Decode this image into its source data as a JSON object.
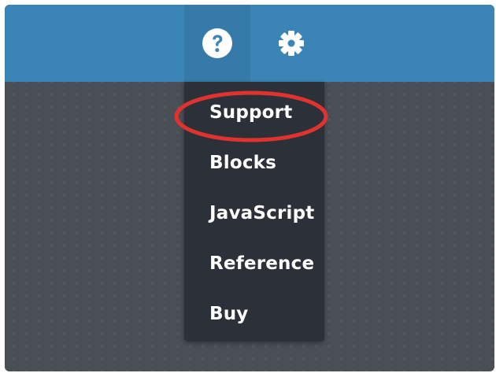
{
  "toolbar": {
    "buttons": [
      {
        "icon": "help-circle-icon",
        "active": true
      },
      {
        "icon": "gear-icon",
        "active": false
      }
    ]
  },
  "help_menu": {
    "items": [
      {
        "label": "Support",
        "highlighted": true
      },
      {
        "label": "Blocks"
      },
      {
        "label": "JavaScript"
      },
      {
        "label": "Reference"
      },
      {
        "label": "Buy"
      }
    ]
  },
  "colors": {
    "toolbar_bg": "#3b85b6",
    "toolbar_active_bg": "#357aa8",
    "workspace_bg": "#4a4e55",
    "menu_bg": "#2c3038",
    "highlight_ring": "#e0322f"
  }
}
